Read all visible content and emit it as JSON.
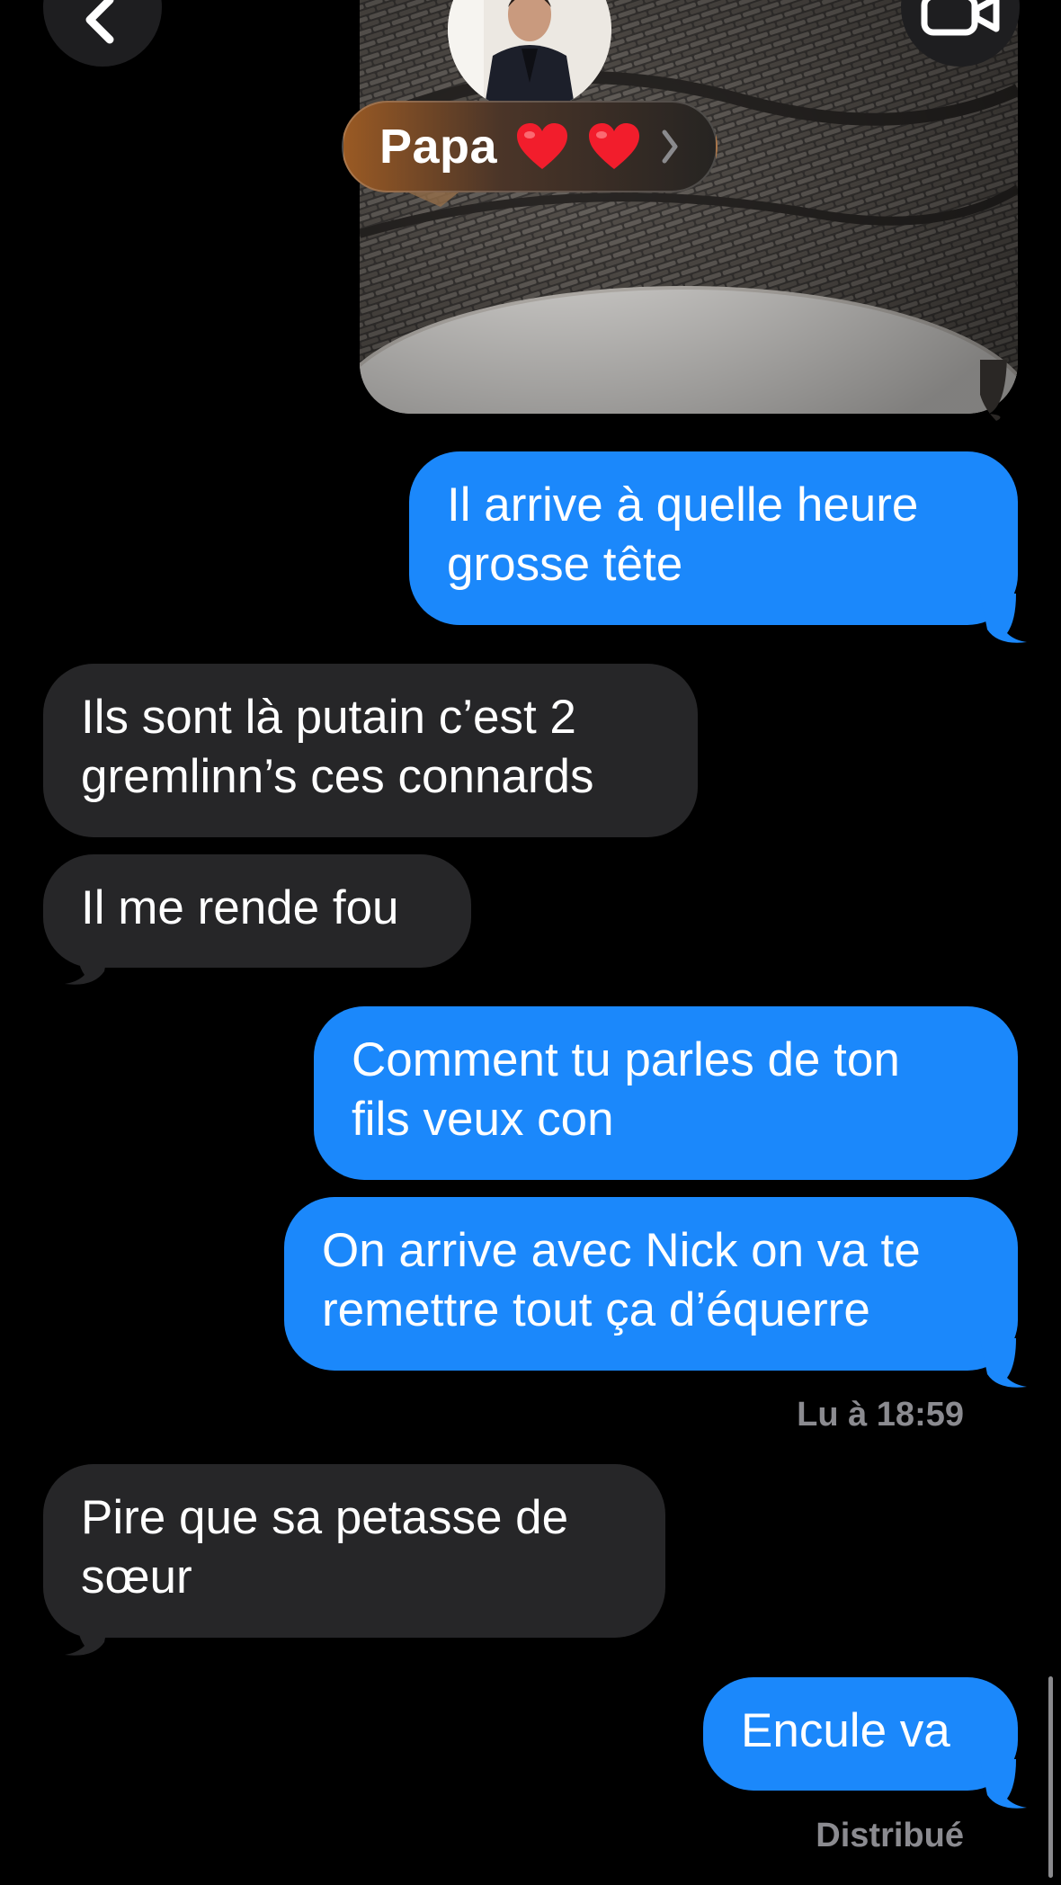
{
  "header": {
    "contact_name": "Papa",
    "heart_icon": "red-heart-icon",
    "back_icon": "chevron-left-icon",
    "video_icon": "video-camera-icon",
    "chevron_icon": "chevron-right-icon"
  },
  "colors": {
    "background": "#000000",
    "sent_bubble": "#1b88fb",
    "received_bubble": "#262628",
    "status_text": "#8b8b90"
  },
  "messages": [
    {
      "direction": "sent",
      "text": "Il arrive à quelle heure\ngrosse tête"
    },
    {
      "direction": "received",
      "text": "Ils sont là putain c’est 2\ngremlinn’s ces connards"
    },
    {
      "direction": "received",
      "text": "Il me rende fou"
    },
    {
      "direction": "sent",
      "text": "Comment tu parles de ton\nfils veux con"
    },
    {
      "direction": "sent",
      "text": "On arrive avec Nick on va te\nremettre tout ça d’équerre"
    },
    {
      "direction": "received",
      "text": "Pire que sa petasse de\nsœur"
    },
    {
      "direction": "sent",
      "text": "Encule va"
    }
  ],
  "read_receipt": "Lu à 18:59",
  "delivery_status": "Distribué"
}
